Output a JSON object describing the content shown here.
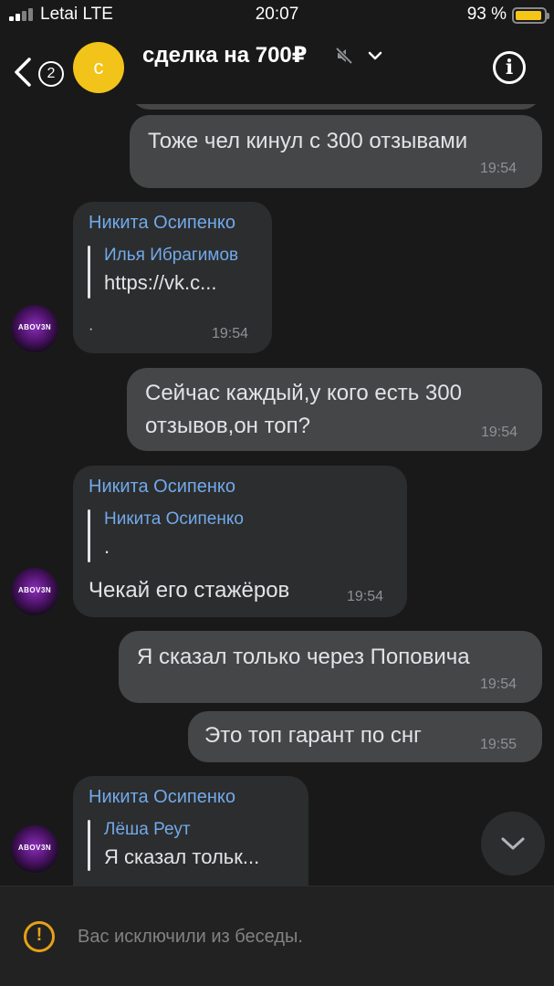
{
  "status_bar": {
    "carrier": "Letai LTE",
    "time": "20:07",
    "battery": "93 %",
    "battery_level": 0.93
  },
  "header": {
    "back_badge": "2",
    "avatar_letter": "с",
    "title": "сделка на 700₽",
    "icons": [
      "back-icon",
      "mute-icon",
      "chevron-down-icon",
      "info-icon"
    ]
  },
  "messages": [
    {
      "direction": "out",
      "text": "Тоже чел кинул с 300 отзывами",
      "time": "19:54"
    },
    {
      "direction": "in",
      "author": "Никита Осипенко",
      "reply_author": "Илья Ибрагимов",
      "reply_text": "https://vk.c...",
      "text": "·",
      "time": "19:54",
      "avatar_text": "ABOV3N"
    },
    {
      "direction": "out",
      "text_lines": [
        "Сейчас каждый,у кого есть 300",
        "отзывов,он топ?"
      ],
      "time": "19:54"
    },
    {
      "direction": "in",
      "author": "Никита Осипенко",
      "reply_author": "Никита Осипенко",
      "reply_text": ".",
      "text": "Чекай его стажёров",
      "time": "19:54",
      "avatar_text": "ABOV3N"
    },
    {
      "direction": "out",
      "text": "Я сказал только через Поповича",
      "time": "19:54"
    },
    {
      "direction": "out",
      "text": "Это топ гарант по снг",
      "time": "19:55"
    },
    {
      "direction": "in",
      "author": "Никита Осипенко",
      "reply_author": "Лёша Реут",
      "reply_text": "Я сказал тольк...",
      "avatar_text": "ABOV3N"
    }
  ],
  "footer": {
    "notice": "Вас исключили из беседы.",
    "icon": "warning-icon"
  },
  "colors": {
    "background": "#19191a",
    "bubble_in": "#2c2d2e",
    "bubble_out": "#454647",
    "author": "#71aaeb",
    "avatar": "#f2c318",
    "warning": "#e6a117"
  }
}
